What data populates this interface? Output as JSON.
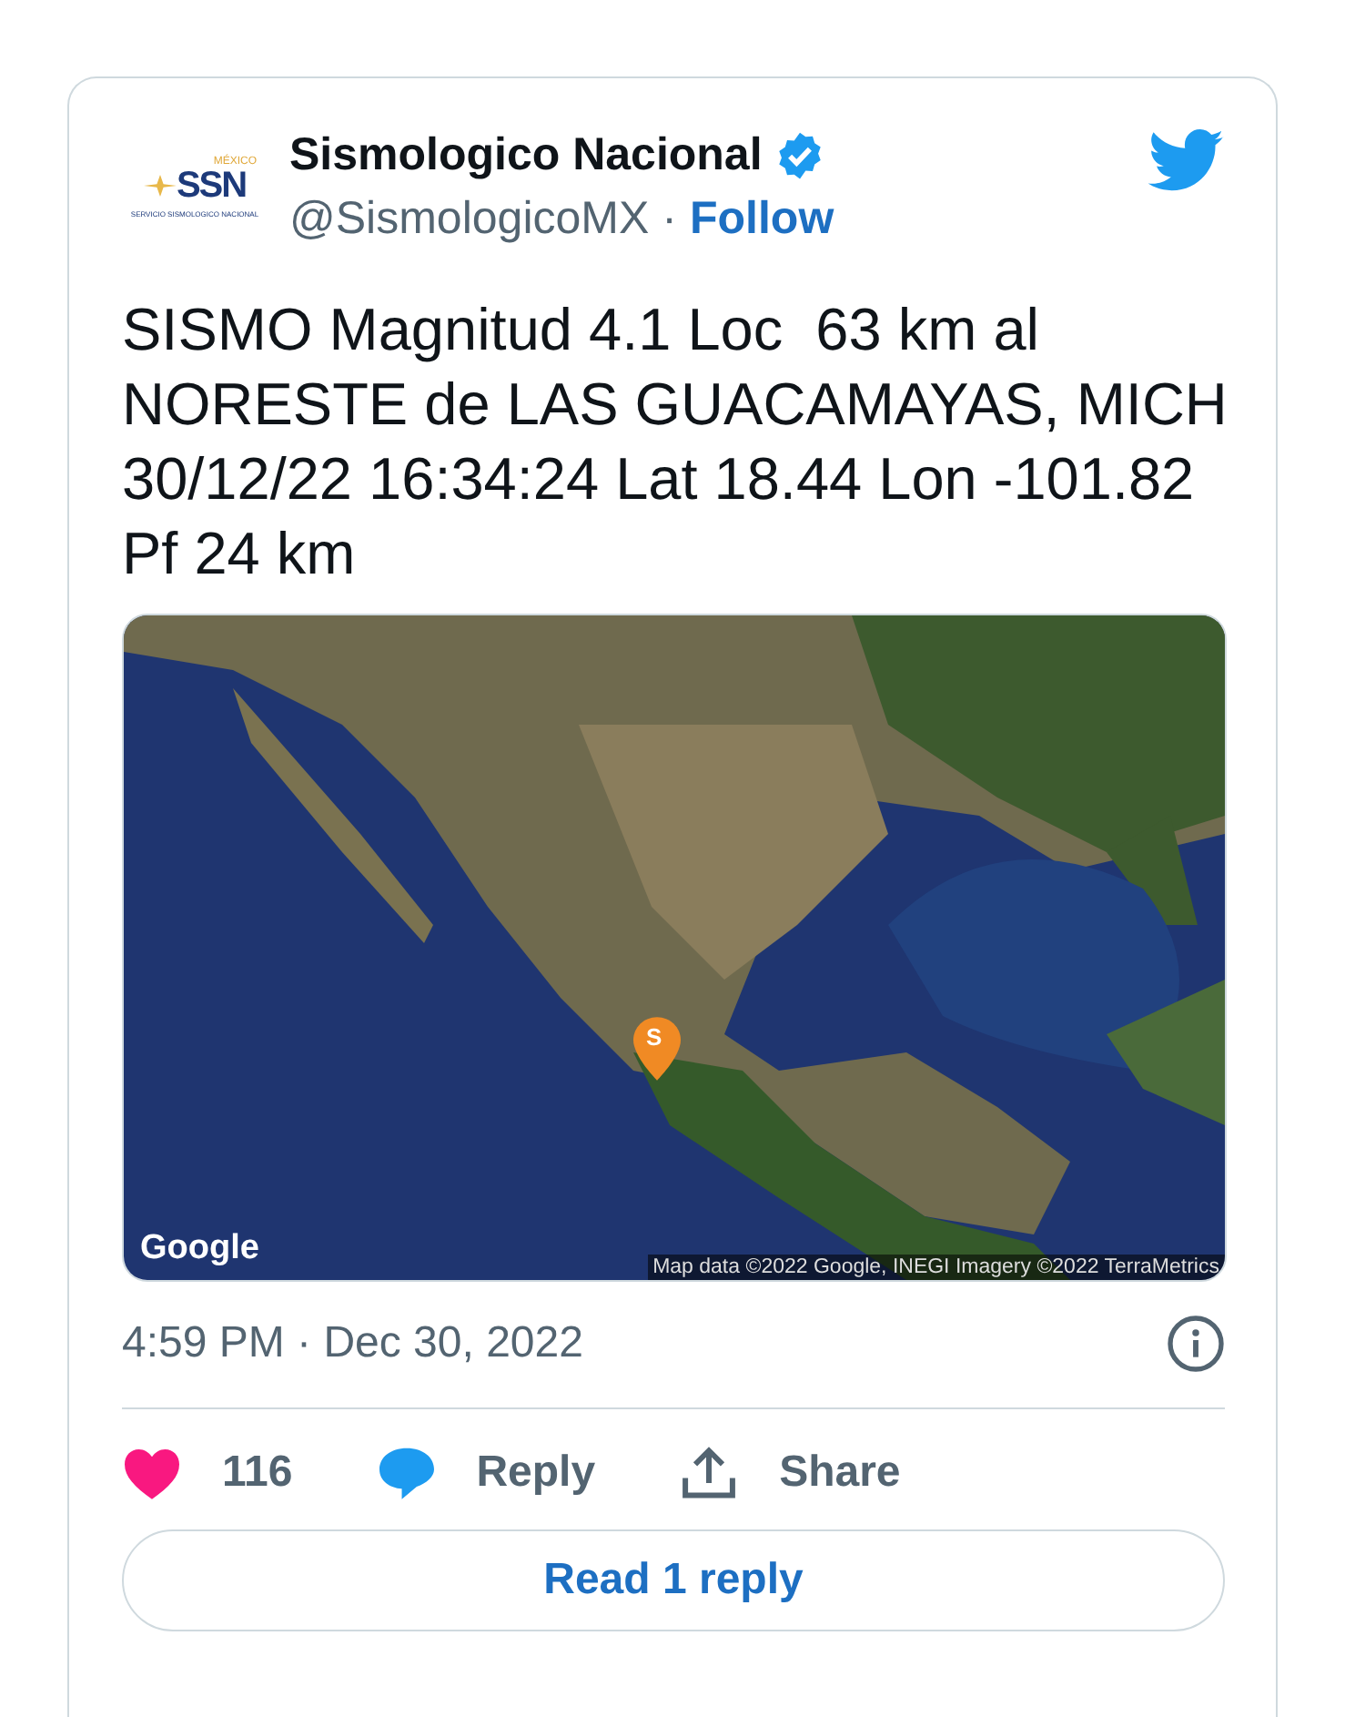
{
  "logo": {
    "country": "MÉXICO",
    "acronym": "SSN",
    "subtitle": "SERVICIO SISMOLOGICO NACIONAL"
  },
  "author": {
    "name": "Sismologico Nacional",
    "verified": true,
    "handle": "@SismologicoMX",
    "separator": "·",
    "follow": "Follow"
  },
  "text": "SISMO Magnitud 4.1 Loc  63 km al NORESTE de LAS GUACAMAYAS, MICH 30/12/22 16:34:24 Lat 18.44 Lon -101.82 Pf 24 km",
  "map": {
    "pin_label": "S",
    "logo": "Google",
    "attribution": "Map data ©2022 Google, INEGI Imagery ©2022 TerraMetrics"
  },
  "timestamp": "4:59 PM · Dec 30, 2022",
  "actions": [
    {
      "kind": "like",
      "label": "116"
    },
    {
      "kind": "reply",
      "label": "Reply"
    },
    {
      "kind": "share",
      "label": "Share"
    }
  ],
  "read_replies": "Read 1 reply"
}
